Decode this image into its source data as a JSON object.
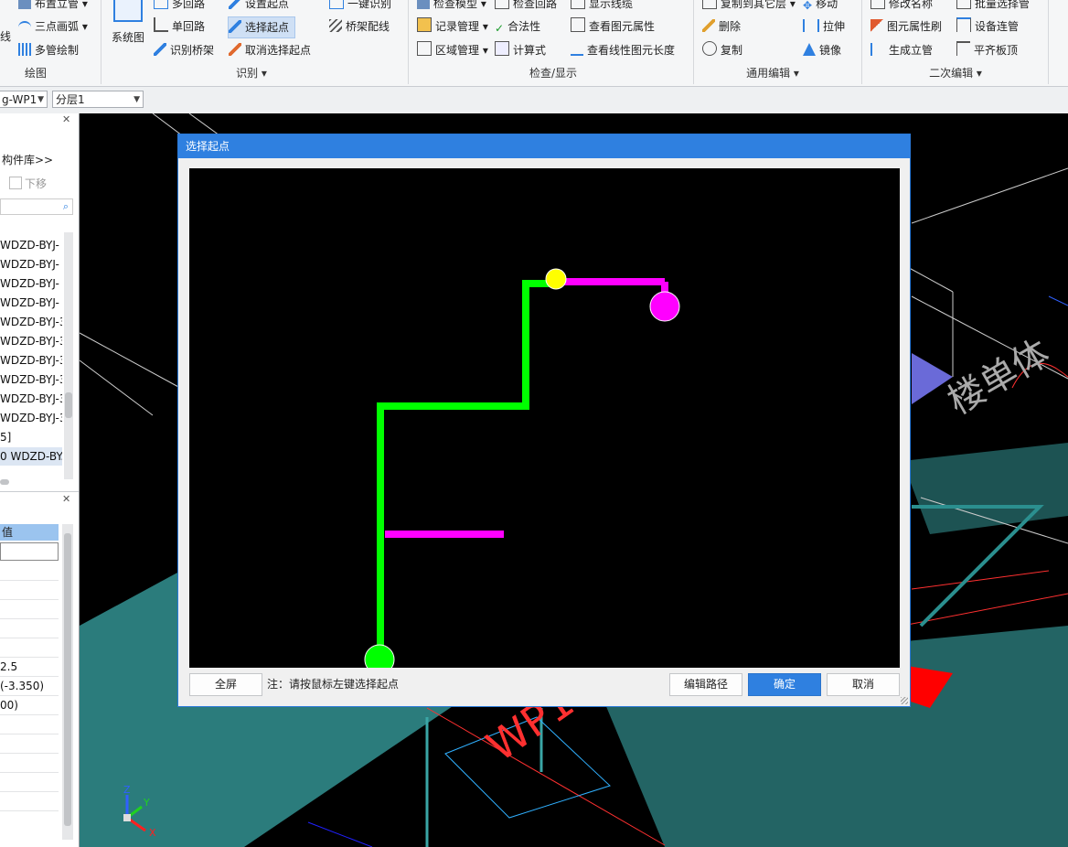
{
  "ribbon": {
    "draw": {
      "items": [
        "布置立管",
        "三点画弧",
        "多管绘制"
      ],
      "left_label": "线",
      "group": "绘图"
    },
    "system_diagram": "系统图",
    "identify": {
      "items": [
        "多回路",
        "单回路",
        "识别桥架",
        "设置起点",
        "选择起点",
        "取消选择起点",
        "一键识别",
        "桥架配线"
      ],
      "group": "识别"
    },
    "check": {
      "items": [
        "检查模型",
        "记录管理",
        "区域管理",
        "检查回路",
        "合法性",
        "计算式",
        "显示线缆",
        "查看图元属性",
        "查看线性图元长度"
      ],
      "group": "检查/显示"
    },
    "edit": {
      "items": [
        "复制到其它层",
        "删除",
        "复制",
        "移动",
        "拉伸",
        "镜像"
      ],
      "group": "通用编辑"
    },
    "edit2": {
      "items": [
        "修改名称",
        "图元属性刷",
        "生成立管",
        "批量选择管",
        "设备连管",
        "平齐板顶"
      ],
      "group": "二次编辑"
    }
  },
  "toolbar": {
    "combo1": "g-WP1",
    "combo2": "分层1"
  },
  "left_panel": {
    "library_link": "构件库>>",
    "move_down": "下移",
    "tree_items": [
      "WDZD-BYJ-",
      "WDZD-BYJ-",
      "WDZD-BYJ-",
      "WDZD-BYJ-",
      "WDZD-BYJ-3",
      "WDZD-BYJ-3",
      "WDZD-BYJ-3",
      "WDZD-BYJ-3",
      "WDZD-BYJ-3",
      "WDZD-BYJ-3",
      "5]",
      "0 WDZD-BY."
    ],
    "prop_header": "值",
    "prop_values": [
      "",
      "",
      "",
      "",
      "",
      "",
      "2.5",
      "(-3.350)",
      "00)",
      "",
      "",
      "",
      "",
      ""
    ]
  },
  "dialog": {
    "title": "选择起点",
    "fullscreen_button": "全屏",
    "note": "注：请按鼠标左键选择起点",
    "edit_path_button": "编辑路径",
    "ok_button": "确定",
    "cancel_button": "取消"
  },
  "colors": {
    "pipe_green": "#00ff00",
    "pipe_magenta": "#ff00ff",
    "start_yellow": "#ffff00",
    "accent_blue": "#2f80e0",
    "cyan_slab": "#3aa6a6"
  },
  "viewport_text": {
    "axis_z": "Z",
    "axis_y": "Y",
    "axis_x": "X"
  }
}
